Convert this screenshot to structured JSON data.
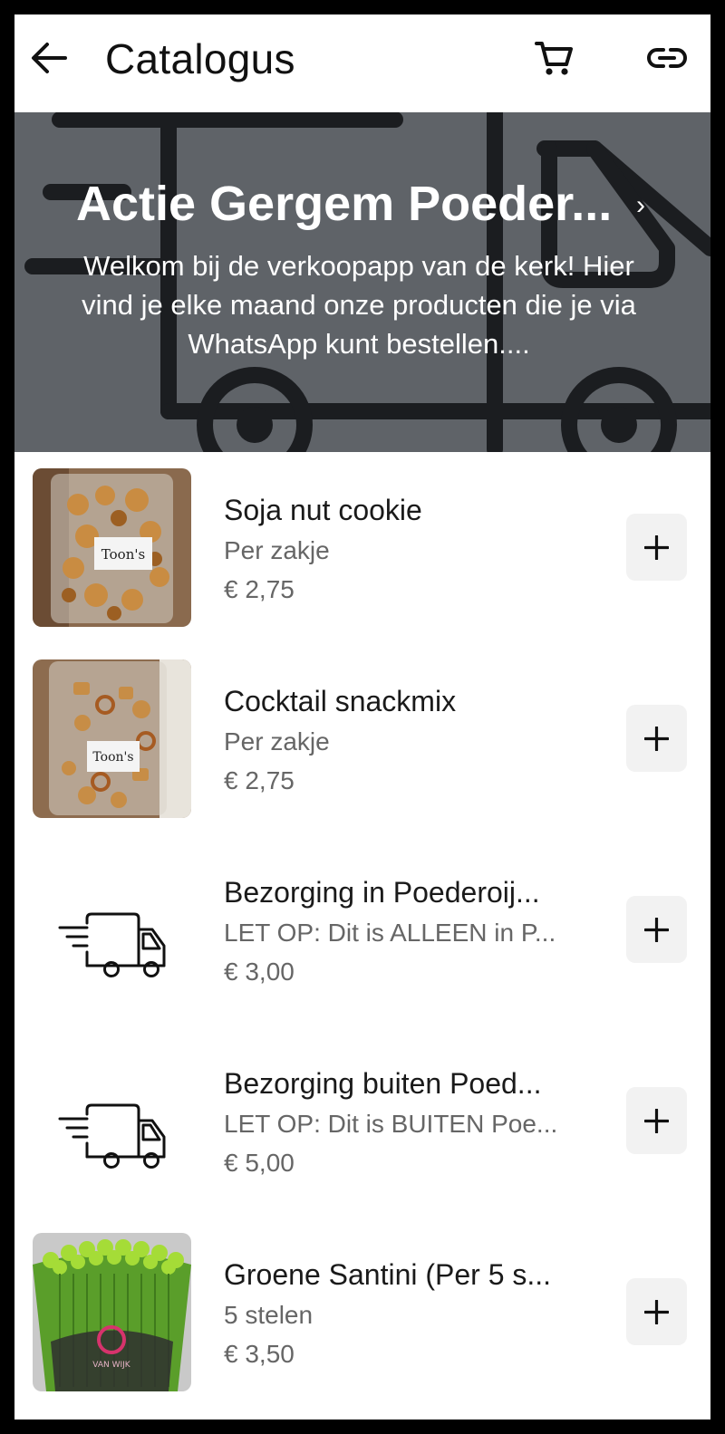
{
  "appbar": {
    "title": "Catalogus",
    "back_icon": "arrow-left-icon",
    "cart_icon": "shopping-cart-icon",
    "link_icon": "link-icon"
  },
  "hero": {
    "title": "Actie Gergem Poeder...",
    "chevron": "›",
    "description": "Welkom bij de verkoopapp van de kerk! Hier vind je elke maand onze producten die je via WhatsApp kunt bestellen...."
  },
  "products": [
    {
      "name": "Soja nut cookie",
      "description": "Per zakje",
      "price": "€ 2,75",
      "image": "photo",
      "label": "Toon's"
    },
    {
      "name": "Cocktail snackmix",
      "description": "Per zakje",
      "price": "€ 2,75",
      "image": "photo",
      "label": "Toon's"
    },
    {
      "name": "Bezorging in Poederoij...",
      "description": "LET OP: Dit is ALLEEN in P...",
      "price": "€ 3,00",
      "image": "truck-icon"
    },
    {
      "name": "Bezorging buiten Poed...",
      "description": "LET OP: Dit is BUITEN Poe...",
      "price": "€ 5,00",
      "image": "truck-icon"
    },
    {
      "name": "Groene Santini (Per 5 s...",
      "description": "5 stelen",
      "price": "€ 3,50",
      "image": "photo",
      "label": "VAN WIJK"
    }
  ],
  "add_icon": "plus-icon"
}
